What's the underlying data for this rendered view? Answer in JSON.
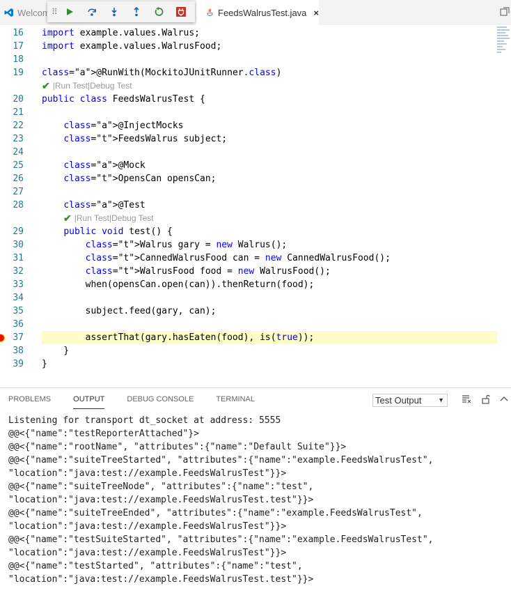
{
  "tabs": {
    "welcome_label": "Welcom",
    "file_label": "FeedsWalrusTest.java",
    "close_glyph": "×"
  },
  "debug_toolbar": {
    "grip": "⠿",
    "buttons": [
      "continue",
      "step-over",
      "step-into",
      "step-out",
      "restart",
      "disconnect"
    ]
  },
  "editor": {
    "lines": [
      {
        "n": "16",
        "code": "import example.values.Walrus;"
      },
      {
        "n": "17",
        "code": "import example.values.WalrusFood;"
      },
      {
        "n": "18",
        "code": ""
      },
      {
        "n": "19",
        "code": "@RunWith(MockitoJUnitRunner.class)"
      },
      {
        "n": "20",
        "code": "public class FeedsWalrusTest {"
      },
      {
        "n": "21",
        "code": ""
      },
      {
        "n": "22",
        "code": "    @InjectMocks"
      },
      {
        "n": "23",
        "code": "    FeedsWalrus subject;"
      },
      {
        "n": "24",
        "code": ""
      },
      {
        "n": "25",
        "code": "    @Mock"
      },
      {
        "n": "26",
        "code": "    OpensCan opensCan;"
      },
      {
        "n": "27",
        "code": ""
      },
      {
        "n": "28",
        "code": "    @Test"
      },
      {
        "n": "29",
        "code": "    public void test() {"
      },
      {
        "n": "30",
        "code": "        Walrus gary = new Walrus();"
      },
      {
        "n": "31",
        "code": "        CannedWalrusFood can = new CannedWalrusFood();"
      },
      {
        "n": "32",
        "code": "        WalrusFood food = new WalrusFood();"
      },
      {
        "n": "33",
        "code": "        when(opensCan.open(can)).thenReturn(food);"
      },
      {
        "n": "34",
        "code": ""
      },
      {
        "n": "35",
        "code": "        subject.feed(gary, can);"
      },
      {
        "n": "36",
        "code": ""
      },
      {
        "n": "37",
        "code": "        assertThat(gary.hasEaten(food), is(true));"
      },
      {
        "n": "38",
        "code": "    }"
      },
      {
        "n": "39",
        "code": "}"
      }
    ],
    "lens": {
      "run": "Run Test",
      "debug": "Debug Test",
      "sep": "|",
      "check": "✔"
    },
    "highlight_color": "#fdfbc7",
    "breakpoint_line": "37"
  },
  "panel": {
    "tabs": [
      "PROBLEMS",
      "OUTPUT",
      "DEBUG CONSOLE",
      "TERMINAL"
    ],
    "active_tab": "OUTPUT",
    "dropdown_value": "Test Output",
    "output_lines": [
      "Listening for transport dt_socket at address: 5555",
      "@@<{\"name\":\"testReporterAttached\"}>",
      "@@<{\"name\":\"rootName\", \"attributes\":{\"name\":\"Default Suite\"}}>",
      "@@<{\"name\":\"suiteTreeStarted\", \"attributes\":{\"name\":\"example.FeedsWalrusTest\",",
      "\"location\":\"java:test://example.FeedsWalrusTest\"}}>",
      "@@<{\"name\":\"suiteTreeNode\", \"attributes\":{\"name\":\"test\",",
      "\"location\":\"java:test://example.FeedsWalrusTest.test\"}}>",
      "@@<{\"name\":\"suiteTreeEnded\", \"attributes\":{\"name\":\"example.FeedsWalrusTest\",",
      "\"location\":\"java:test://example.FeedsWalrusTest\"}}>",
      "@@<{\"name\":\"testSuiteStarted\", \"attributes\":{\"name\":\"example.FeedsWalrusTest\",",
      "\"location\":\"java:test://example.FeedsWalrusTest\"}}>",
      "@@<{\"name\":\"testStarted\", \"attributes\":{\"name\":\"test\",",
      "\"location\":\"java:test://example.FeedsWalrusTest.test\"}}>"
    ]
  }
}
